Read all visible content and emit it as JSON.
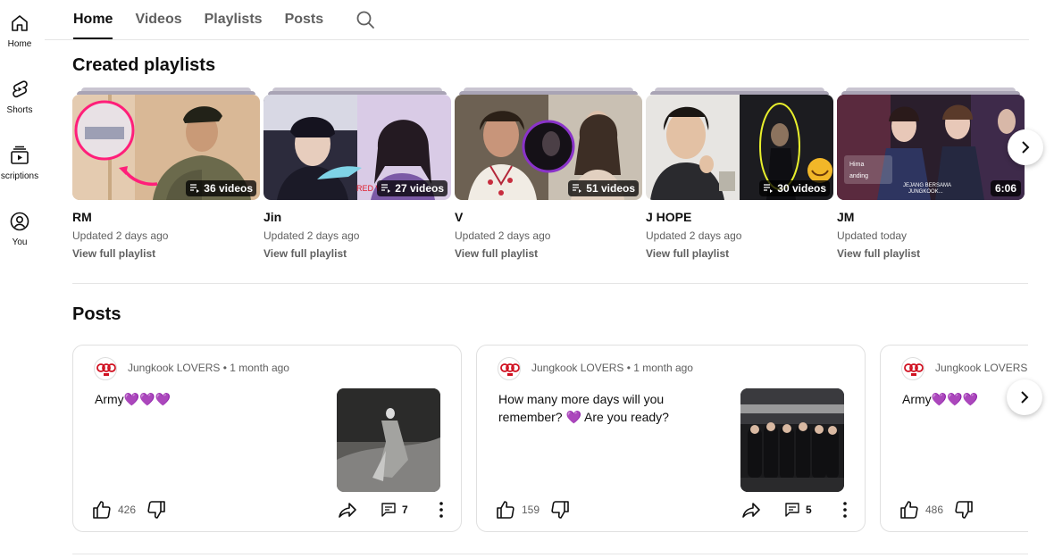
{
  "sidebar": {
    "items": [
      {
        "label": "Home",
        "icon": "home-icon"
      },
      {
        "label": "Shorts",
        "icon": "shorts-icon"
      },
      {
        "label": "scriptions",
        "icon": "subscriptions-icon"
      },
      {
        "label": "You",
        "icon": "you-icon"
      }
    ]
  },
  "tabs": {
    "home": "Home",
    "videos": "Videos",
    "playlists": "Playlists",
    "posts": "Posts",
    "search_icon": "search-icon"
  },
  "created_playlists": {
    "title": "Created playlists",
    "items": [
      {
        "title": "RM",
        "updated": "Updated 2 days ago",
        "link": "View full playlist",
        "badge": "36 videos"
      },
      {
        "title": "Jin",
        "updated": "Updated 2 days ago",
        "link": "View full playlist",
        "badge": "27 videos"
      },
      {
        "title": "V",
        "updated": "Updated 2 days ago",
        "link": "View full playlist",
        "badge": "51 videos"
      },
      {
        "title": "J HOPE",
        "updated": "Updated 2 days ago",
        "link": "View full playlist",
        "badge": "30 videos"
      },
      {
        "title": "JM",
        "updated": "Updated today",
        "link": "View full playlist",
        "badge": "6:06"
      }
    ]
  },
  "posts": {
    "title": "Posts",
    "items": [
      {
        "author": "Jungkook LOVERS • 1 month ago",
        "text": "Army💜💜💜",
        "likes": "426",
        "comments": "7"
      },
      {
        "author": "Jungkook LOVERS • 1 month ago",
        "text": "How many more days will you remember? 💜 Are you ready?",
        "likes": "159",
        "comments": "5"
      },
      {
        "author": "Jungkook LOVERS •",
        "text": "Army💜💜💜",
        "likes": "486",
        "comments": ""
      }
    ]
  },
  "colors": {
    "accent_purple": "#a020f0",
    "avatar_red": "#d01020",
    "text_primary": "#0f0f0f",
    "text_secondary": "#606060"
  }
}
